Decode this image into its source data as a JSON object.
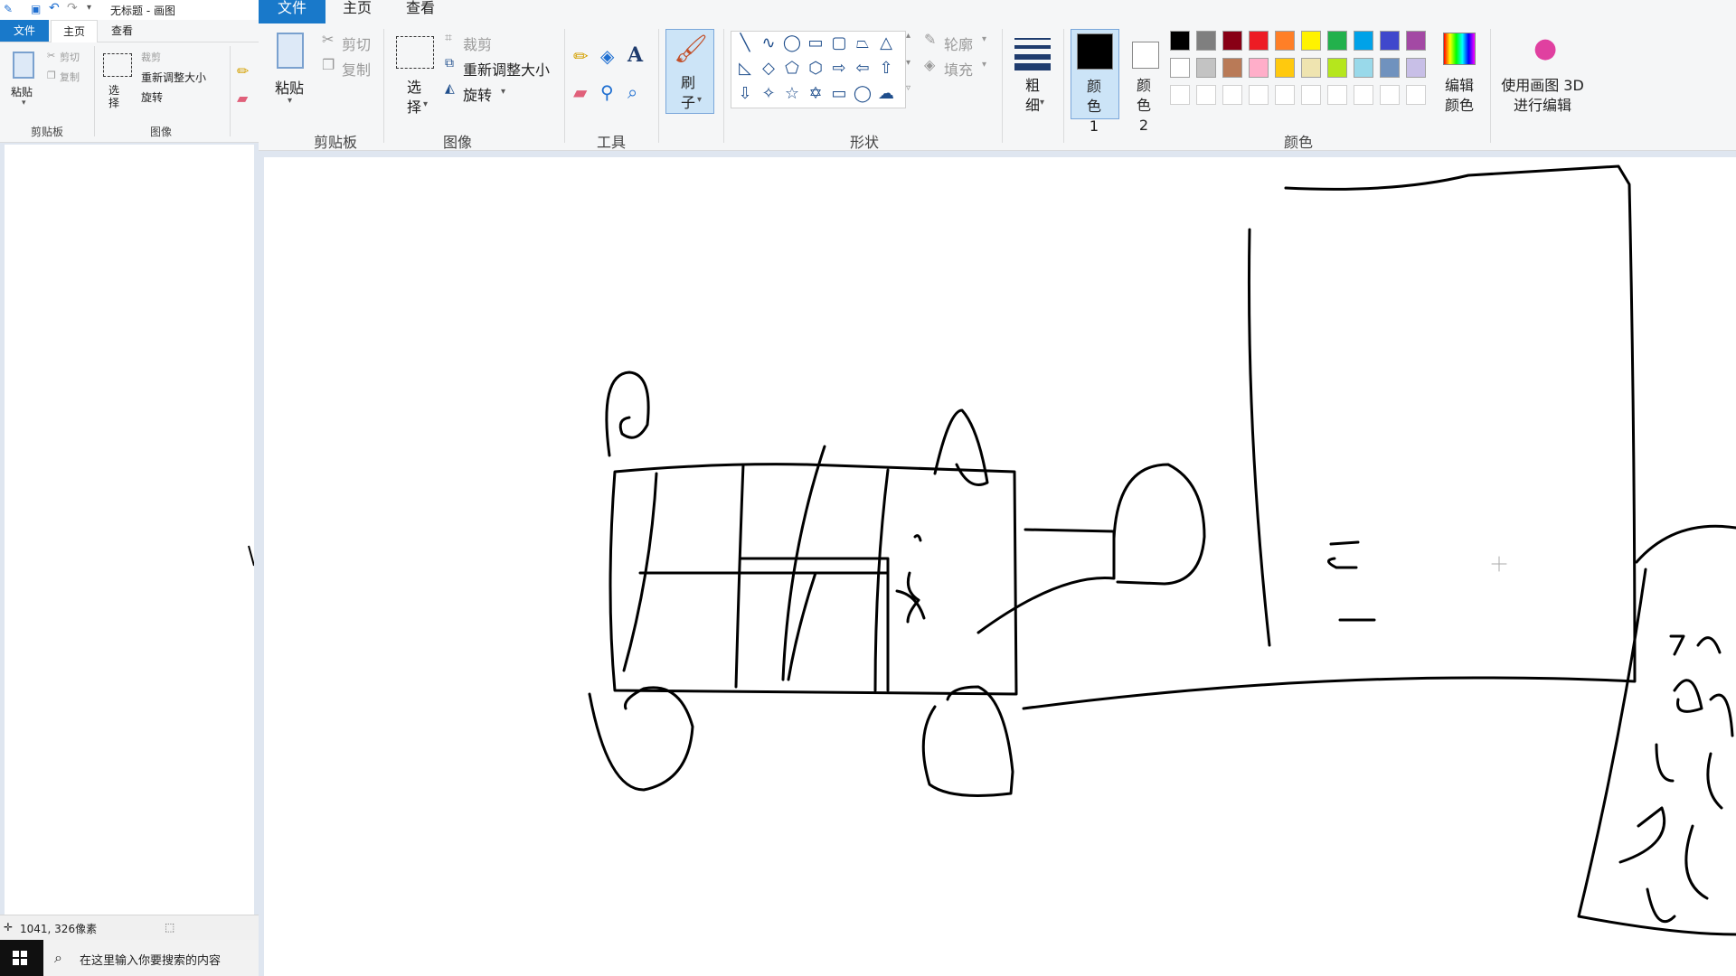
{
  "small_window": {
    "title": "无标题 - 画图",
    "tabs": [
      "文件",
      "主页",
      "查看"
    ],
    "ribbon": {
      "paste": "粘贴",
      "cut": "剪切",
      "copy": "复制",
      "select": "选择",
      "crop": "裁剪",
      "resize": "重新调整大小",
      "rotate": "旋转",
      "group_clipboard": "剪贴板",
      "group_image": "图像"
    },
    "status_coords": "1041, 326像素",
    "search_placeholder": "在这里输入你要搜索的内容"
  },
  "main_window": {
    "tabs": [
      "文件",
      "主页",
      "查看"
    ],
    "ribbon": {
      "paste": "粘贴",
      "cut": "剪切",
      "copy": "复制",
      "select": "选择",
      "crop": "裁剪",
      "resize": "重新调整大小",
      "rotate": "旋转",
      "brush": "刷子",
      "outline": "轮廓",
      "fill": "填充",
      "thickness": "粗细",
      "color1": "颜色 1",
      "color2": "颜色 2",
      "edit_colors": "编辑颜色",
      "paint3d": "使用画图 3D 进行编辑",
      "groups": {
        "clipboard": "剪贴板",
        "image": "图像",
        "tools": "工具",
        "shapes": "形状",
        "colors": "颜色"
      }
    },
    "palette_row1": [
      "#000000",
      "#7f7f7f",
      "#880015",
      "#ed1c24",
      "#ff7f27",
      "#fff200",
      "#22b14c",
      "#00a2e8",
      "#3f48cc",
      "#a349a4"
    ],
    "palette_row2": [
      "#ffffff",
      "#c3c3c3",
      "#b97a57",
      "#ffaec9",
      "#ffc90e",
      "#efe4b0",
      "#b5e61d",
      "#99d9ea",
      "#7092be",
      "#c8bfe7"
    ],
    "color1": "#000000",
    "color2": "#ffffff"
  },
  "icons": [
    "paste-icon",
    "cut-icon",
    "copy-icon",
    "select-icon",
    "crop-icon",
    "resize-icon",
    "rotate-icon",
    "pencil-icon",
    "fill-bucket-icon",
    "text-icon",
    "eraser-icon",
    "color-picker-icon",
    "magnifier-icon",
    "brush-icon",
    "thickness-icon",
    "edit-colors-icon",
    "paint3d-icon",
    "windows-logo-icon",
    "search-icon"
  ]
}
